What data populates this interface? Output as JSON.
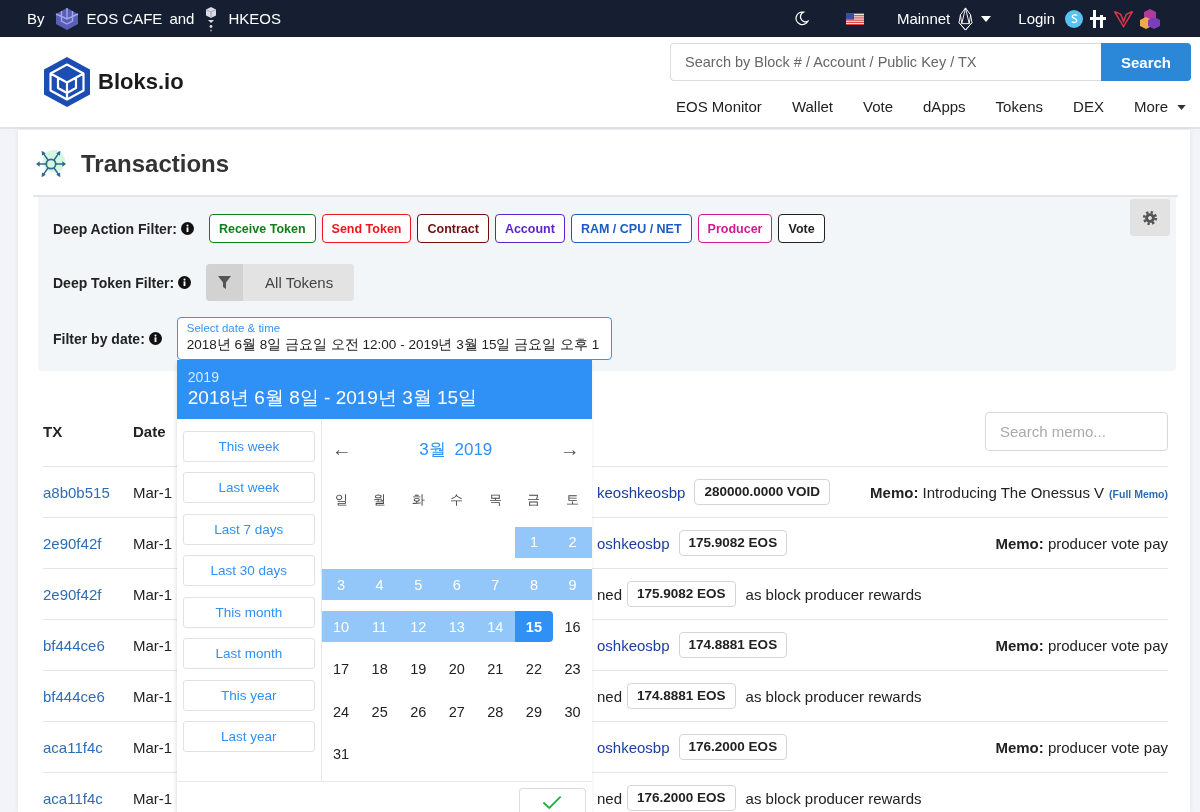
{
  "top_bar": {
    "credit_prefix": "By",
    "credit_first": "EOS CAFE",
    "credit_joiner": "and",
    "credit_second": "HKEOS",
    "network": "Mainnet",
    "login": "Login"
  },
  "header": {
    "brand": "Bloks.io",
    "search": {
      "placeholder": "Search by Block # / Account / Public Key / TX",
      "button": "Search"
    },
    "nav": [
      {
        "label": "EOS Monitor",
        "dropdown": false
      },
      {
        "label": "Wallet",
        "dropdown": false
      },
      {
        "label": "Vote",
        "dropdown": false
      },
      {
        "label": "dApps",
        "dropdown": false
      },
      {
        "label": "Tokens",
        "dropdown": false
      },
      {
        "label": "DEX",
        "dropdown": false
      },
      {
        "label": "More",
        "dropdown": true
      }
    ]
  },
  "page": {
    "title": "Transactions"
  },
  "filters": {
    "action_label": "Deep Action Filter:",
    "actions": [
      {
        "label": "Receive Token",
        "color": "#12801a"
      },
      {
        "label": "Send Token",
        "color": "#f2141c"
      },
      {
        "label": "Contract",
        "color": "#6f1010"
      },
      {
        "label": "Account",
        "color": "#5b24cc"
      },
      {
        "label": "RAM / CPU / NET",
        "color": "#1a5cc2"
      },
      {
        "label": "Producer",
        "color": "#d2198e"
      },
      {
        "label": "Vote",
        "color": "#222222"
      }
    ],
    "token_label": "Deep Token Filter:",
    "token_button": "All Tokens",
    "date_label": "Filter by date:",
    "date_field": {
      "label": "Select date & time",
      "value": "2018년 6월 8일 금요일 오전 12:00 - 2019년 3월 15일 금요일 오후 1"
    }
  },
  "date_picker": {
    "year": "2019",
    "range": "2018년 6월 8일 - 2019년 3월 15일",
    "presets": [
      "This week",
      "Last week",
      "Last 7 days",
      "Last 30 days",
      "This month",
      "Last month",
      "This year",
      "Last year"
    ],
    "prev": "←",
    "month": "3월 2019",
    "next": "→",
    "weekdays": [
      "일",
      "월",
      "화",
      "수",
      "목",
      "금",
      "토"
    ],
    "weeks": [
      [
        {
          "label": "1",
          "in_range": true,
          "selected": false
        },
        {
          "label": "2",
          "in_range": true,
          "selected": false
        }
      ],
      [
        {
          "label": "3",
          "in_range": true,
          "selected": false
        },
        {
          "label": "4",
          "in_range": true,
          "selected": false
        },
        {
          "label": "5",
          "in_range": true,
          "selected": false
        },
        {
          "label": "6",
          "in_range": true,
          "selected": false
        },
        {
          "label": "7",
          "in_range": true,
          "selected": false
        },
        {
          "label": "8",
          "in_range": true,
          "selected": false
        },
        {
          "label": "9",
          "in_range": true,
          "selected": false
        }
      ],
      [
        {
          "label": "10",
          "in_range": true,
          "selected": false
        },
        {
          "label": "11",
          "in_range": true,
          "selected": false
        },
        {
          "label": "12",
          "in_range": true,
          "selected": false
        },
        {
          "label": "13",
          "in_range": true,
          "selected": false
        },
        {
          "label": "14",
          "in_range": true,
          "selected": false
        },
        {
          "label": "15",
          "in_range": true,
          "selected": true
        },
        {
          "label": "16",
          "in_range": false,
          "selected": false
        }
      ],
      [
        {
          "label": "17",
          "in_range": false,
          "selected": false
        },
        {
          "label": "18",
          "in_range": false,
          "selected": false
        },
        {
          "label": "19",
          "in_range": false,
          "selected": false
        },
        {
          "label": "20",
          "in_range": false,
          "selected": false
        },
        {
          "label": "21",
          "in_range": false,
          "selected": false
        },
        {
          "label": "22",
          "in_range": false,
          "selected": false
        },
        {
          "label": "23",
          "in_range": false,
          "selected": false
        }
      ],
      [
        {
          "label": "24",
          "in_range": false,
          "selected": false
        },
        {
          "label": "25",
          "in_range": false,
          "selected": false
        },
        {
          "label": "26",
          "in_range": false,
          "selected": false
        },
        {
          "label": "27",
          "in_range": false,
          "selected": false
        },
        {
          "label": "28",
          "in_range": false,
          "selected": false
        },
        {
          "label": "29",
          "in_range": false,
          "selected": false
        },
        {
          "label": "30",
          "in_range": false,
          "selected": false
        }
      ],
      [
        {
          "label": "31",
          "in_range": false,
          "selected": false
        }
      ]
    ]
  },
  "table": {
    "columns": [
      "TX",
      "Date"
    ],
    "search": {
      "placeholder": "Search memo..."
    },
    "rows": [
      {
        "kind": "transfer",
        "tx": "a8b0b515",
        "date": "Mar-1",
        "account": "keoshkeosbp",
        "amount": "280000.0000 VOID",
        "memo": "**Memo:** Introducing The Onessus V",
        "full_memo": "(Full Memo)"
      },
      {
        "kind": "transfer",
        "tx": "2e90f42f",
        "date": "Mar-1",
        "account": "oshkeosbp",
        "amount": "175.9082 EOS",
        "memo": "**Memo:** producer vote pay"
      },
      {
        "kind": "claim",
        "tx": "2e90f42f",
        "date": "Mar-1",
        "lead": "ned",
        "amount": "175.9082 EOS",
        "text": "as block producer rewards"
      },
      {
        "kind": "transfer",
        "tx": "bf444ce6",
        "date": "Mar-1",
        "account": "oshkeosbp",
        "amount": "174.8881 EOS",
        "memo": "**Memo:** producer vote pay"
      },
      {
        "kind": "claim",
        "tx": "bf444ce6",
        "date": "Mar-1",
        "lead": "ned",
        "amount": "174.8881 EOS",
        "text": "as block producer rewards"
      },
      {
        "kind": "transfer",
        "tx": "aca11f4c",
        "date": "Mar-1",
        "account": "oshkeosbp",
        "amount": "176.2000 EOS",
        "memo": "**Memo:** producer vote pay"
      },
      {
        "kind": "claim",
        "tx": "aca11f4c",
        "date": "Mar-1",
        "lead": "ned",
        "amount": "176.2000 EOS",
        "text": "as block producer rewards"
      }
    ]
  }
}
